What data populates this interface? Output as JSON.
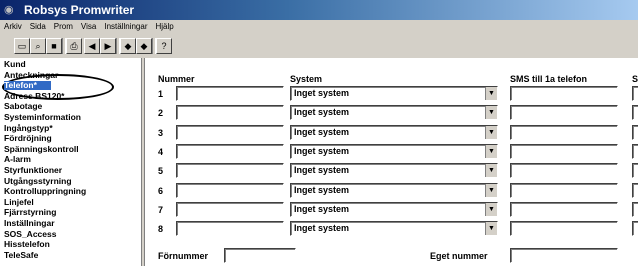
{
  "window": {
    "title": "Robsys Promwriter"
  },
  "menu": [
    "Arkiv",
    "Sida",
    "Prom",
    "Visa",
    "Inställningar",
    "Hjälp"
  ],
  "toolbar": {
    "buttons": [
      {
        "name": "new-file-icon",
        "glyph": "▭"
      },
      {
        "name": "open-file-icon",
        "glyph": "⌕"
      },
      {
        "name": "save-icon",
        "glyph": "■"
      },
      {
        "name": "print-icon",
        "glyph": "⎙"
      },
      {
        "name": "prev-icon",
        "glyph": "◀"
      },
      {
        "name": "next-icon",
        "glyph": "▶"
      },
      {
        "name": "read-icon",
        "glyph": "◆"
      },
      {
        "name": "write-icon",
        "glyph": "◆"
      },
      {
        "name": "help-icon",
        "glyph": "?"
      }
    ]
  },
  "nav": {
    "items": [
      "Kund",
      "Anteckningar",
      "Telefon*",
      "Adress BS120*",
      "Sabotage",
      "Systeminformation",
      "Ingångstyp*",
      "Fördröjning",
      "Spänningskontroll",
      "A-larm",
      "Styrfunktioner",
      "Utgångsstyrning",
      "Kontrolluppringning",
      "Linjefel",
      "Fjärrstyrning",
      "Inställningar",
      "SOS_Access",
      "Hisstelefon",
      "TeleSafe"
    ],
    "selected_index": 2
  },
  "table": {
    "headers": {
      "nummer": "Nummer",
      "system": "System",
      "sms": "SMS till 1a telefon",
      "cut": "S"
    },
    "rows": [
      {
        "num": "1",
        "nummer": "",
        "system": "Inget system",
        "sms": ""
      },
      {
        "num": "2",
        "nummer": "",
        "system": "Inget system",
        "sms": ""
      },
      {
        "num": "3",
        "nummer": "",
        "system": "Inget system",
        "sms": ""
      },
      {
        "num": "4",
        "nummer": "",
        "system": "Inget system",
        "sms": ""
      },
      {
        "num": "5",
        "nummer": "",
        "system": "Inget system",
        "sms": ""
      },
      {
        "num": "6",
        "nummer": "",
        "system": "Inget system",
        "sms": ""
      },
      {
        "num": "7",
        "nummer": "",
        "system": "Inget system",
        "sms": ""
      },
      {
        "num": "8",
        "nummer": "",
        "system": "Inget system",
        "sms": ""
      }
    ]
  },
  "footer": {
    "fornummer_label": "Förnummer",
    "fornummer_value": "",
    "eget_label": "Eget nummer",
    "eget_value": ""
  },
  "colors": {
    "titlebar_start": "#0a246a",
    "titlebar_end": "#a6caf0",
    "selection": "#316ac5",
    "chrome": "#d4d0c8"
  }
}
